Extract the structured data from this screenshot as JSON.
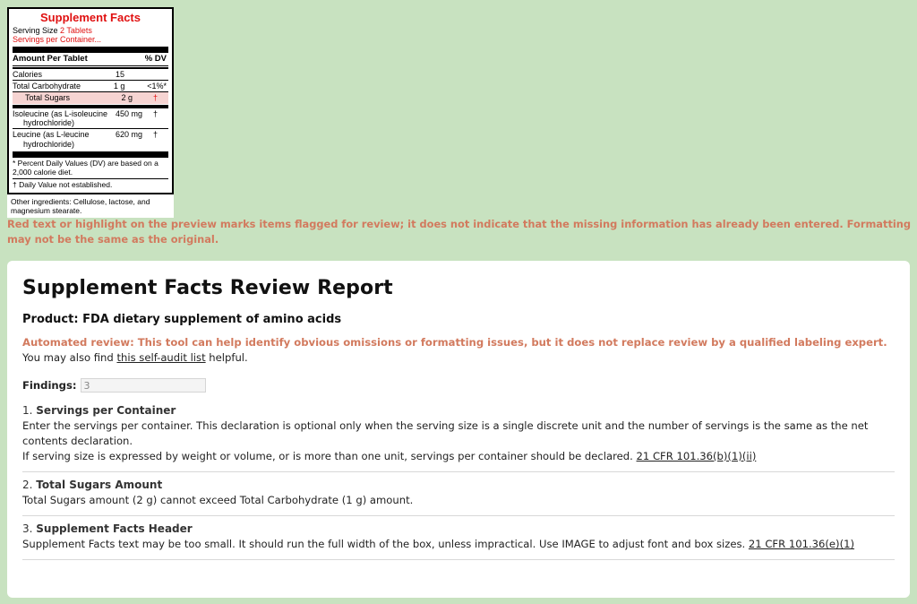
{
  "label": {
    "title": "Supplement Facts",
    "serving_size_label": "Serving Size",
    "serving_size_value": "2 Tablets",
    "servings_per_container": "Servings per Container...",
    "amount_header": "Amount Per Tablet",
    "dv_header": "% DV",
    "rows": [
      {
        "name": "Calories",
        "amount": "15",
        "dv": ""
      },
      {
        "name": "Total Carbohydrate",
        "amount": "1 g",
        "dv": "<1%*"
      },
      {
        "name": "Total Sugars",
        "amount": "2 g",
        "dv": "†"
      }
    ],
    "amino_rows": [
      {
        "name": "Isoleucine (as L-isoleucine",
        "name2": "hydrochloride)",
        "amount": "450 mg",
        "dv": "†"
      },
      {
        "name": "Leucine (as L-leucine",
        "name2": "hydrochloride)",
        "amount": "620 mg",
        "dv": "†"
      }
    ],
    "footnote1": "* Percent Daily Values (DV) are based on a 2,000 calorie diet.",
    "footnote2": "† Daily Value not established.",
    "other_ingredients": "Other ingredients: Cellulose, lactose, and magnesium stearate."
  },
  "notice": "Red text or highlight on the preview marks items flagged for review; it does not indicate that the missing information has already been entered. Formatting may not be the same as the original.",
  "report": {
    "title": "Supplement Facts Review Report",
    "product": "Product: FDA dietary supplement of amino acids",
    "automated": "Automated review: This tool can help identify obvious omissions or formatting issues, but it does not replace review by a qualified labeling expert.",
    "also_prefix": "You may also find ",
    "also_link": "this self-audit list",
    "also_suffix": " helpful.",
    "findings_label": "Findings:",
    "findings_count": "3",
    "findings": [
      {
        "number": "1.",
        "title": "Servings per Container",
        "line1": "Enter the servings per container. This declaration is optional only when the serving size is a single discrete unit and the number of servings is the same as the net contents declaration.",
        "line2": "If serving size is expressed by weight or volume, or is more than one unit, servings per container should be declared. ",
        "link": "21 CFR 101.36(b)(1)(ii)"
      },
      {
        "number": "2.",
        "title": "Total Sugars Amount",
        "line1": "Total Sugars amount (2 g) cannot exceed Total Carbohydrate (1 g) amount."
      },
      {
        "number": "3.",
        "title": "Supplement Facts Header",
        "line1": "Supplement Facts text may be too small. It should run the full width of the box, unless impractical. Use IMAGE to adjust font and box sizes. ",
        "link": "21 CFR 101.36(e)(1)"
      }
    ]
  }
}
